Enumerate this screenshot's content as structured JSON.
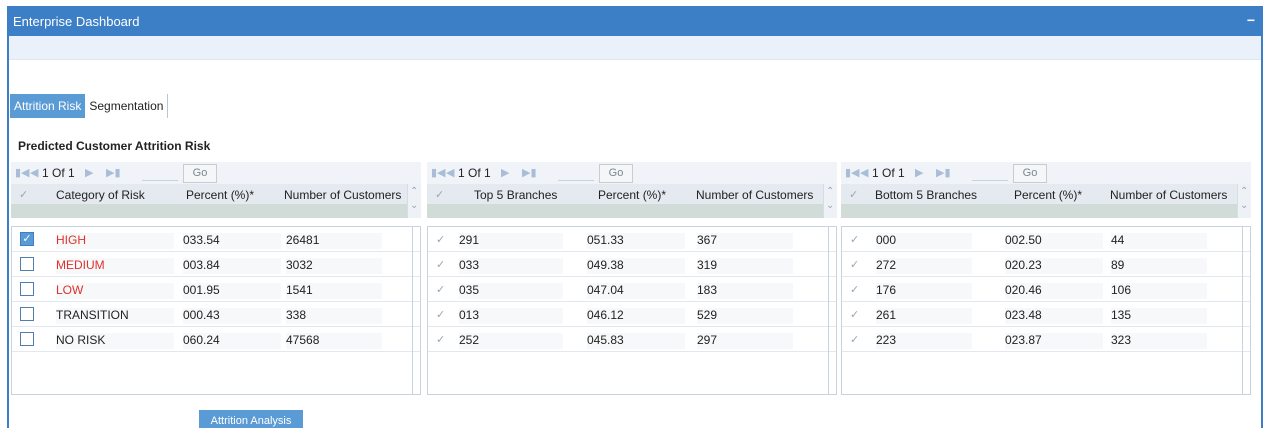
{
  "window": {
    "title": "Enterprise Dashboard",
    "minimize_symbol": "−"
  },
  "tabs": [
    {
      "label": "Attrition Risk",
      "active": true
    },
    {
      "label": "Segmentation",
      "active": false
    }
  ],
  "section_title": "Predicted Customer Attrition Risk",
  "pager": {
    "page_text": "1 Of 1",
    "go_label": "Go"
  },
  "panels": [
    {
      "headers": [
        "Category of Risk",
        "Percent (%)*",
        "Number of Customers"
      ],
      "rows": [
        {
          "name": "HIGH",
          "percent": "033.54",
          "count": "26481",
          "checked": true,
          "red": true
        },
        {
          "name": "MEDIUM",
          "percent": "003.84",
          "count": "3032",
          "checked": false,
          "red": true
        },
        {
          "name": "LOW",
          "percent": "001.95",
          "count": "1541",
          "checked": false,
          "red": true
        },
        {
          "name": "TRANSITION",
          "percent": "000.43",
          "count": "338",
          "checked": false,
          "red": false
        },
        {
          "name": "NO RISK",
          "percent": "060.24",
          "count": "47568",
          "checked": false,
          "red": false
        }
      ]
    },
    {
      "headers": [
        "Top 5 Branches",
        "Percent (%)*",
        "Number of Customers"
      ],
      "rows": [
        {
          "name": "291",
          "percent": "051.33",
          "count": "367"
        },
        {
          "name": "033",
          "percent": "049.38",
          "count": "319"
        },
        {
          "name": "035",
          "percent": "047.04",
          "count": "183"
        },
        {
          "name": "013",
          "percent": "046.12",
          "count": "529"
        },
        {
          "name": "252",
          "percent": "045.83",
          "count": "297"
        }
      ]
    },
    {
      "headers": [
        "Bottom 5 Branches",
        "Percent (%)*",
        "Number of Customers"
      ],
      "rows": [
        {
          "name": "000",
          "percent": "002.50",
          "count": "44"
        },
        {
          "name": "272",
          "percent": "020.23",
          "count": "89"
        },
        {
          "name": "176",
          "percent": "020.46",
          "count": "106"
        },
        {
          "name": "261",
          "percent": "023.48",
          "count": "135"
        },
        {
          "name": "223",
          "percent": "023.87",
          "count": "323"
        }
      ]
    }
  ],
  "buttons": {
    "attrition_analysis": "Attrition Analysis"
  },
  "icons": {
    "first": "first-page-icon",
    "prev": "prev-page-icon",
    "next": "next-page-icon",
    "last": "last-page-icon",
    "tick": "checkmark-icon",
    "scroll_up": "scroll-up-icon",
    "scroll_down": "scroll-down-icon"
  },
  "colors": {
    "accent": "#3c7fc7",
    "tab_active": "#5b9bd5",
    "risk_red": "#e0302a"
  }
}
